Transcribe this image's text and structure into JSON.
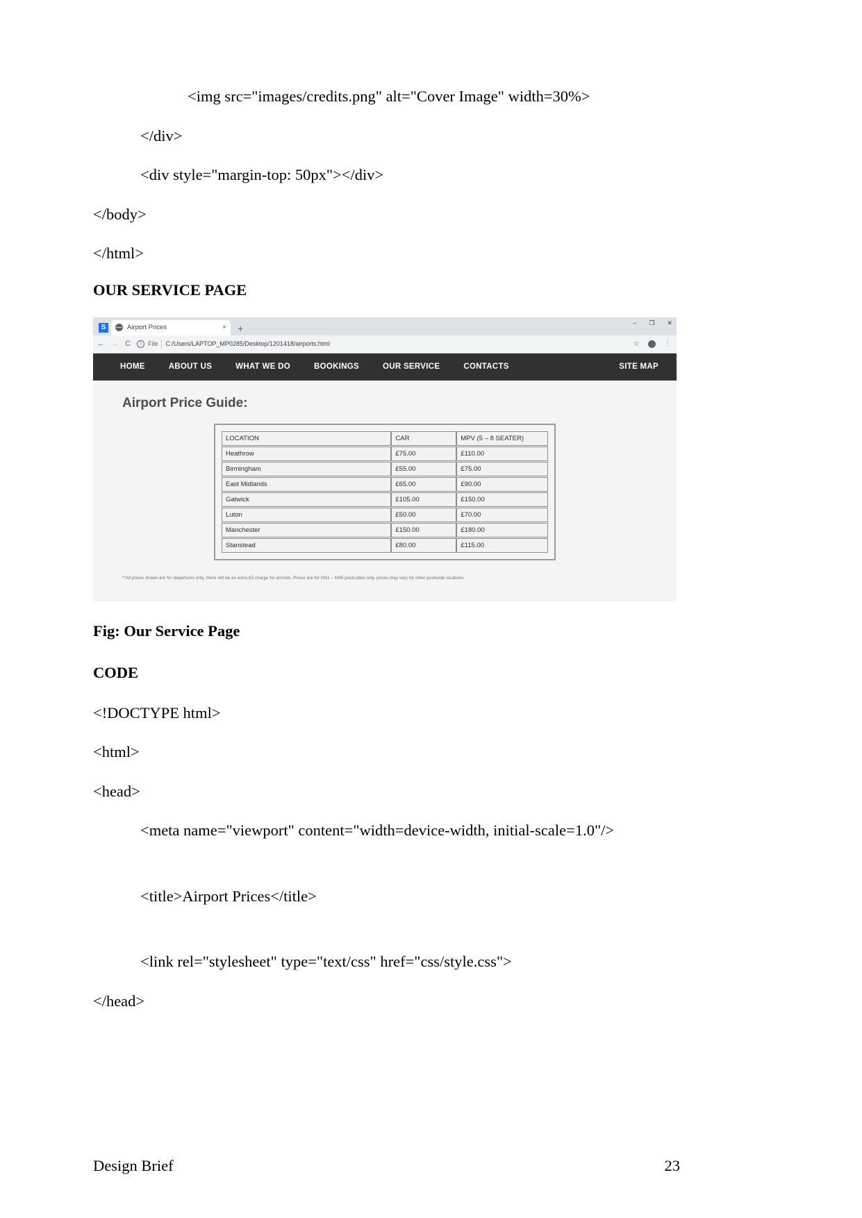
{
  "document": {
    "code_lines_top": [
      {
        "text": "<img src=\"images/credits.png\" alt=\"Cover Image\" width=30%>",
        "indent": 2
      },
      {
        "text": "</div>",
        "indent": 1
      },
      {
        "text": "<div style=\"margin-top: 50px\"></div>",
        "indent": 1
      },
      {
        "text": "</body>",
        "indent": 0
      },
      {
        "text": "</html>",
        "indent": 0
      }
    ],
    "heading_our_service": "OUR SERVICE PAGE",
    "figure_caption": "Fig: Our Service Page",
    "heading_code": "CODE",
    "code_lines_bottom": [
      {
        "text": "<!DOCTYPE html>",
        "indent": 0
      },
      {
        "text": "<html>",
        "indent": 0
      },
      {
        "text": "<head>",
        "indent": 0
      },
      {
        "text": "<meta name=\"viewport\" content=\"width=device-width, initial-scale=1.0\"/>",
        "indent": 1
      },
      {
        "text": "<title>Airport Prices</title>",
        "indent": 1
      },
      {
        "text": "<link rel=\"stylesheet\" type=\"text/css\" href=\"css/style.css\">",
        "indent": 1
      },
      {
        "text": "</head>",
        "indent": 0
      }
    ],
    "footer": {
      "left": "Design Brief",
      "page_number": "23"
    }
  },
  "browser": {
    "brand_badge": "S",
    "tab": {
      "title": "Airport Prices",
      "close_label": "×"
    },
    "new_tab_label": "+",
    "window_controls": {
      "minimize": "–",
      "maximize": "❐",
      "close": "✕"
    },
    "toolbar": {
      "back": "←",
      "forward": "→",
      "reload": "C",
      "info_icon": "i",
      "file_label": "File",
      "url": "C:/Users/LAPTOP_MP0285/Desktop/1201418/airports.html",
      "star": "☆",
      "menu": "⋮"
    }
  },
  "webpage": {
    "nav_items": [
      "HOME",
      "ABOUT US",
      "WHAT WE DO",
      "BOOKINGS",
      "OUR SERVICE",
      "CONTACTS"
    ],
    "nav_right": "SITE MAP",
    "page_title": "Airport Price Guide:",
    "table": {
      "headers": [
        "LOCATION",
        "CAR",
        "MPV (5 – 8 SEATER)"
      ],
      "rows": [
        [
          "Heathrow",
          "£75.00",
          "£110.00"
        ],
        [
          "Birmingham",
          "£55.00",
          "£75.00"
        ],
        [
          "East Midlands",
          "£65.00",
          "£90.00"
        ],
        [
          "Gatwick",
          "£105.00",
          "£150.00"
        ],
        [
          "Luton",
          "£50.00",
          "£70.00"
        ],
        [
          "Manchester",
          "£150.00",
          "£180.00"
        ],
        [
          "Stanstead",
          "£80.00",
          "£115.00"
        ]
      ]
    },
    "footnote": "**All prices shown are for departures only, there will be an extra £5 charge for arrivals. Prices are for NN1 – NN5 postcodes only, prices may vary for other postcode locations"
  },
  "colors": {
    "nav_bg": "#313131",
    "site_bg": "#f4f4f4",
    "chrome_tabstrip": "#dee1e6",
    "chrome_omnibar": "#f1f3f4"
  }
}
